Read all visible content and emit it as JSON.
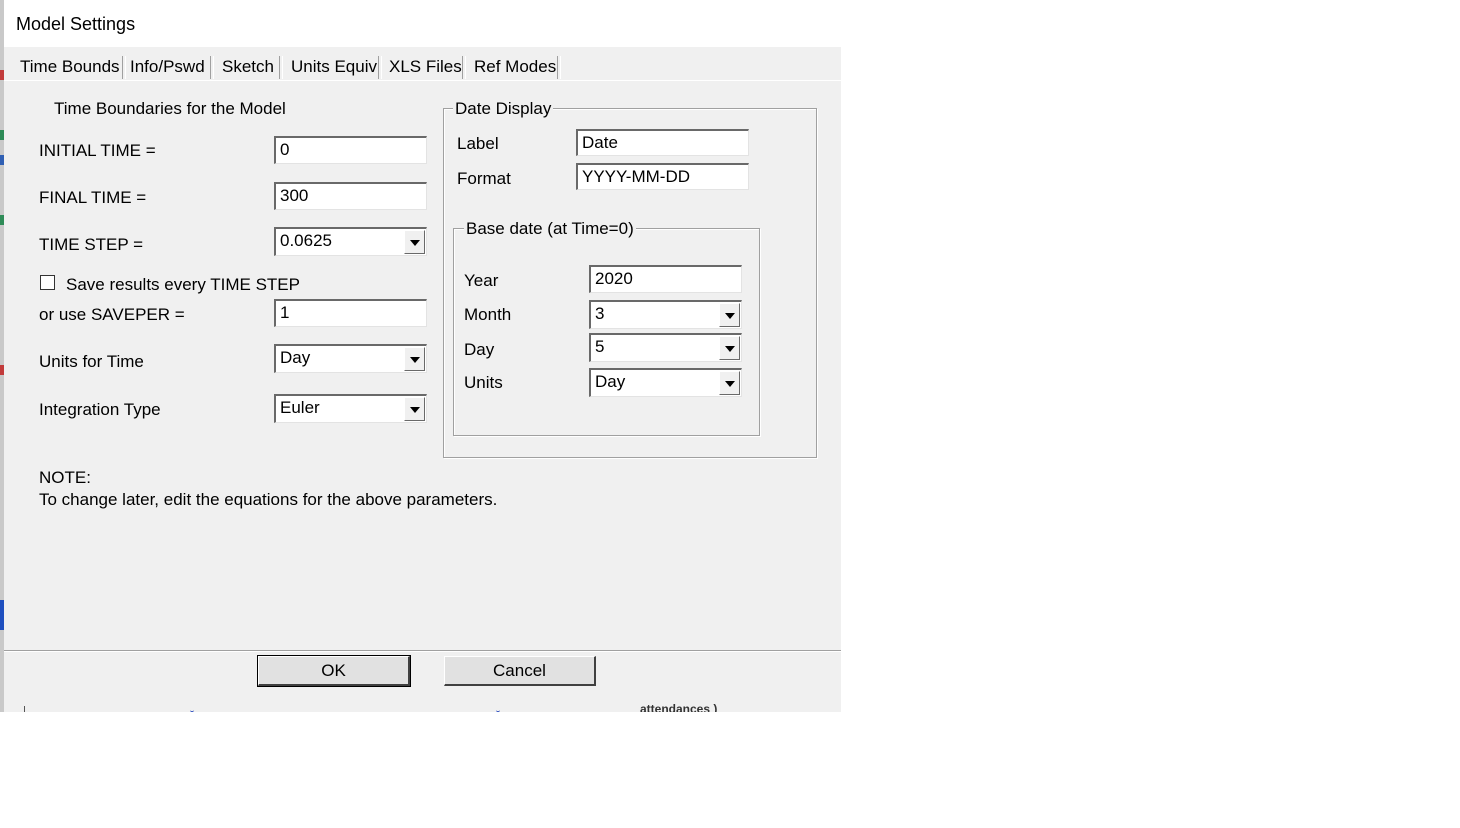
{
  "window": {
    "title": "Model Settings"
  },
  "tabs": [
    {
      "label": "Time Bounds",
      "active": true
    },
    {
      "label": "Info/Pswd"
    },
    {
      "label": "Sketch"
    },
    {
      "label": "Units Equiv"
    },
    {
      "label": "XLS Files"
    },
    {
      "label": "Ref Modes"
    }
  ],
  "time_bounds": {
    "heading": "Time Boundaries for the Model",
    "initial_time": {
      "label": "INITIAL TIME =",
      "value": "0"
    },
    "final_time": {
      "label": "FINAL TIME =",
      "value": "300"
    },
    "time_step": {
      "label": "TIME STEP =",
      "value": "0.0625"
    },
    "save_every": {
      "label": "Save results every TIME STEP",
      "checked": false
    },
    "saveper": {
      "label": "or use SAVEPER =",
      "value": "1"
    },
    "units_for_time": {
      "label": "Units for Time",
      "value": "Day"
    },
    "integration_type": {
      "label": "Integration Type",
      "value": "Euler"
    }
  },
  "date_display": {
    "legend": "Date Display",
    "label": {
      "label": "Label",
      "value": "Date"
    },
    "format": {
      "label": "Format",
      "value": "YYYY-MM-DD"
    },
    "base_date": {
      "legend": "Base date (at Time=0)",
      "year": {
        "label": "Year",
        "value": "2020"
      },
      "month": {
        "label": "Month",
        "value": "3"
      },
      "day": {
        "label": "Day",
        "value": "5"
      },
      "units": {
        "label": "Units",
        "value": "Day"
      }
    }
  },
  "note": {
    "title": "NOTE:",
    "text": "To change later, edit the equations for the above parameters."
  },
  "buttons": {
    "ok": "OK",
    "cancel": "Cancel"
  },
  "background": {
    "partial_text": "attendances )"
  },
  "colors": {
    "dialog_bg": "#f0f0f0",
    "input_bg": "#ffffff",
    "button_bg": "#e1e1e1"
  }
}
